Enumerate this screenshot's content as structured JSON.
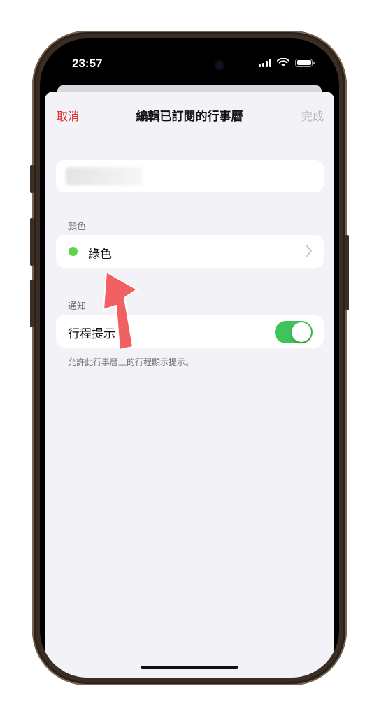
{
  "status_bar": {
    "time": "23:57"
  },
  "nav": {
    "cancel_label": "取消",
    "title": "編輯已訂閱的行事曆",
    "done_label": "完成"
  },
  "sections": {
    "color_header": "顏色",
    "color_value": "綠色",
    "notify_header": "通知",
    "toggle_label": "行程提示",
    "toggle_on": true,
    "footer_note": "允許此行事曆上的行程顯示提示。"
  },
  "colors": {
    "accent_red": "#e0352b",
    "selected_color": "#5fd44a",
    "toggle_green": "#3ec55a",
    "annotation_arrow": "#f26161"
  },
  "icons": [
    "chevron-right-icon",
    "cellular-signal-icon",
    "wifi-icon",
    "battery-icon"
  ]
}
